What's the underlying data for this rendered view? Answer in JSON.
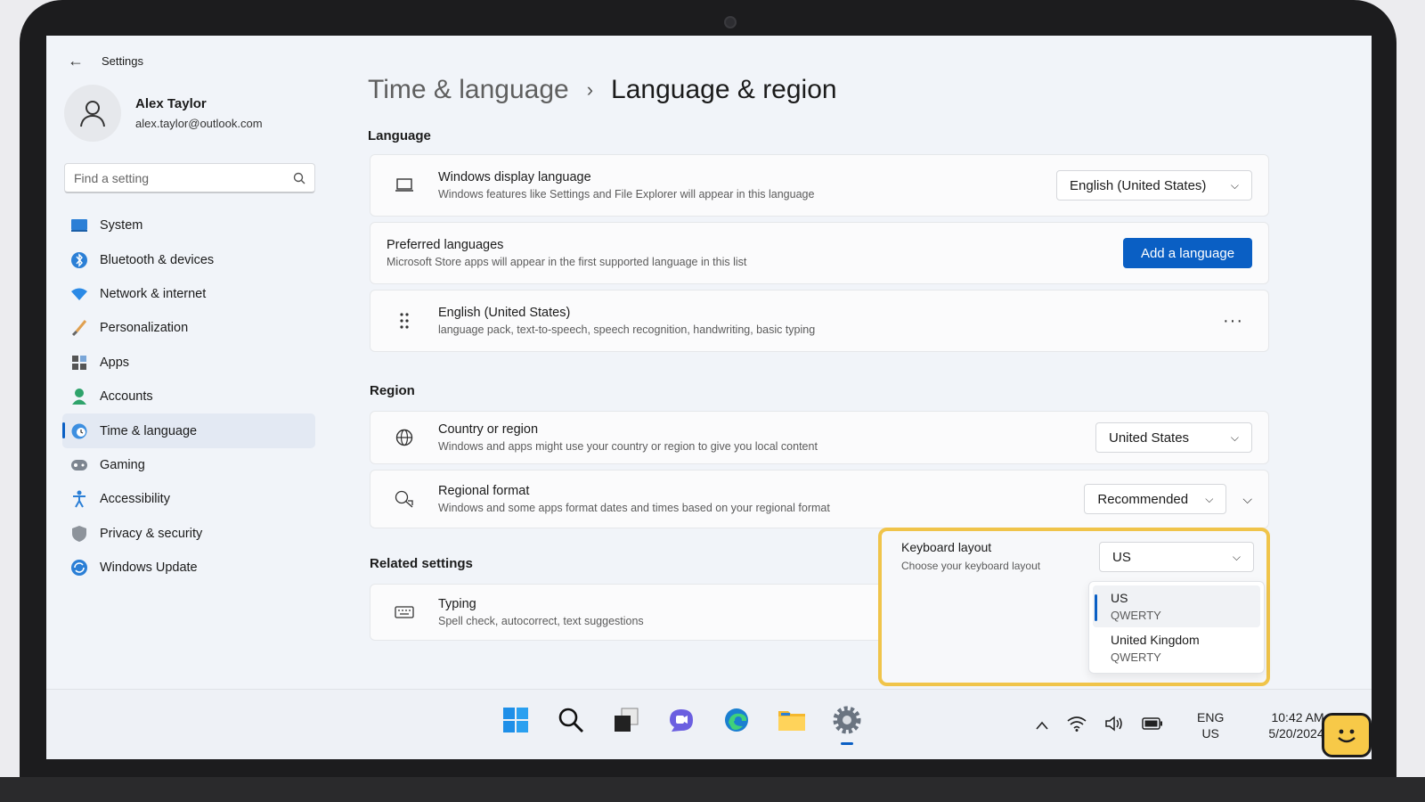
{
  "window": {
    "title": "Settings"
  },
  "user": {
    "name": "Alex Taylor",
    "email": "alex.taylor@outlook.com"
  },
  "search": {
    "placeholder": "Find a setting"
  },
  "sidebar": {
    "items": [
      {
        "label": "System",
        "icon": "monitor-icon"
      },
      {
        "label": "Bluetooth & devices",
        "icon": "bluetooth-icon"
      },
      {
        "label": "Network & internet",
        "icon": "wifi-icon"
      },
      {
        "label": "Personalization",
        "icon": "brush-icon"
      },
      {
        "label": "Apps",
        "icon": "apps-icon"
      },
      {
        "label": "Accounts",
        "icon": "person-icon"
      },
      {
        "label": "Time & language",
        "icon": "clock-globe-icon",
        "active": true
      },
      {
        "label": "Gaming",
        "icon": "gamepad-icon"
      },
      {
        "label": "Accessibility",
        "icon": "accessibility-icon"
      },
      {
        "label": "Privacy & security",
        "icon": "shield-icon"
      },
      {
        "label": "Windows Update",
        "icon": "update-icon"
      }
    ]
  },
  "breadcrumb": {
    "parent": "Time & language",
    "separator": "›",
    "current": "Language & region"
  },
  "language": {
    "title": "Language",
    "display": {
      "title": "Windows display language",
      "desc": "Windows features like Settings and File Explorer will appear in this language",
      "value": "English (United States)"
    },
    "preferred": {
      "title": "Preferred languages",
      "desc": "Microsoft Store apps will appear in the first supported language in this list",
      "button": "Add a language"
    },
    "entry": {
      "title": "English (United States)",
      "desc": "language pack, text-to-speech, speech recognition, handwriting, basic typing",
      "more": "···"
    }
  },
  "region": {
    "title": "Region",
    "country": {
      "title": "Country or region",
      "desc": "Windows and apps might use your country or region to give you local content",
      "value": "United States"
    },
    "format": {
      "title": "Regional format",
      "desc": "Windows and some apps format dates and times based on your regional format",
      "value": "Recommended"
    }
  },
  "related": {
    "title": "Related settings",
    "typing": {
      "title": "Typing",
      "desc": "Spell check, autocorrect, text suggestions"
    }
  },
  "keyboard": {
    "title": "Keyboard layout",
    "desc": "Choose your keyboard layout",
    "value": "US",
    "options": [
      {
        "name": "US",
        "sub": "QWERTY",
        "selected": true
      },
      {
        "name": "United Kingdom",
        "sub": "QWERTY",
        "selected": false
      }
    ]
  },
  "taskbar": {
    "lang_top": "ENG",
    "lang_bottom": "US",
    "time": "10:42 AM",
    "date": "5/20/2024"
  },
  "colors": {
    "accent": "#0a5fc4",
    "highlight": "#f0c44a"
  }
}
